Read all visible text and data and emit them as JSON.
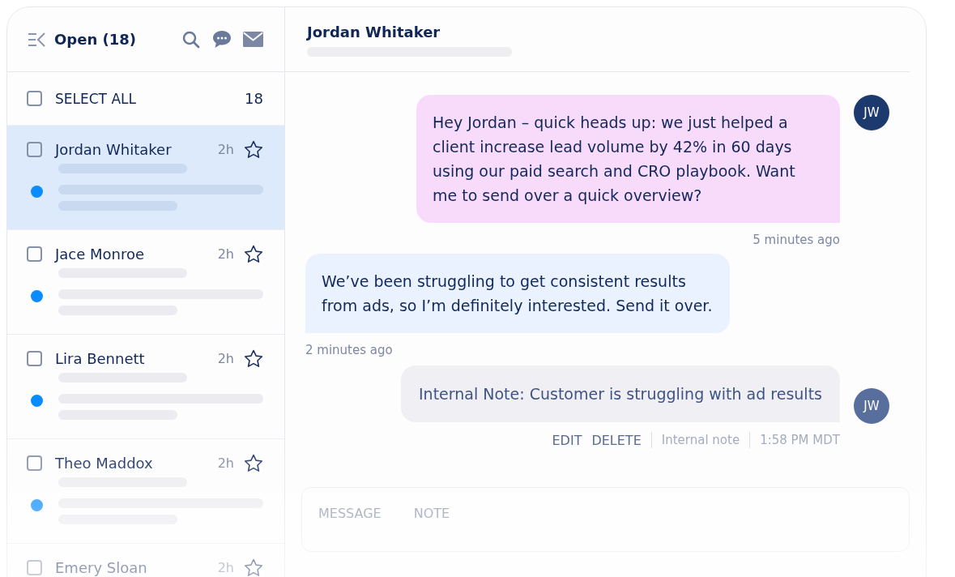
{
  "inbox": {
    "title": "Open (18)",
    "select_all": {
      "label": "SELECT ALL",
      "count": "18",
      "checked": false
    }
  },
  "conversations": [
    {
      "name": "Jordan Whitaker",
      "time": "2h",
      "selected": true,
      "checked": false,
      "starred": false,
      "unread": true
    },
    {
      "name": "Jace Monroe",
      "time": "2h",
      "selected": false,
      "checked": false,
      "starred": false,
      "unread": true
    },
    {
      "name": "Lira Bennett",
      "time": "2h",
      "selected": false,
      "checked": false,
      "starred": false,
      "unread": true
    },
    {
      "name": "Theo Maddox",
      "time": "2h",
      "selected": false,
      "checked": false,
      "starred": false,
      "unread": true
    },
    {
      "name": "Emery Sloan",
      "time": "2h",
      "selected": false,
      "checked": false,
      "starred": false
    }
  ],
  "thread": {
    "contact": "Jordan Whitaker",
    "messages": [
      {
        "kind": "outgoing",
        "text": "Hey Jordan – quick heads up: we just helped a client increase lead volume by 42% in 60 days using our paid search and CRO playbook. Want me to send over a quick overview?",
        "time": "5 minutes ago",
        "avatar": "JW"
      },
      {
        "kind": "incoming",
        "text": "We’ve been struggling to get consistent results from ads, so I’m definitely interested. Send it over.",
        "time": "2 minutes ago"
      },
      {
        "kind": "note",
        "text": "Internal Note: Customer is struggling with ad results",
        "avatar": "JW",
        "actions": [
          "EDIT",
          "DELETE"
        ],
        "label": "Internal note",
        "time": "1:58 PM MDT"
      }
    ]
  },
  "composer": {
    "tabs": [
      "MESSAGE",
      "NOTE"
    ]
  }
}
